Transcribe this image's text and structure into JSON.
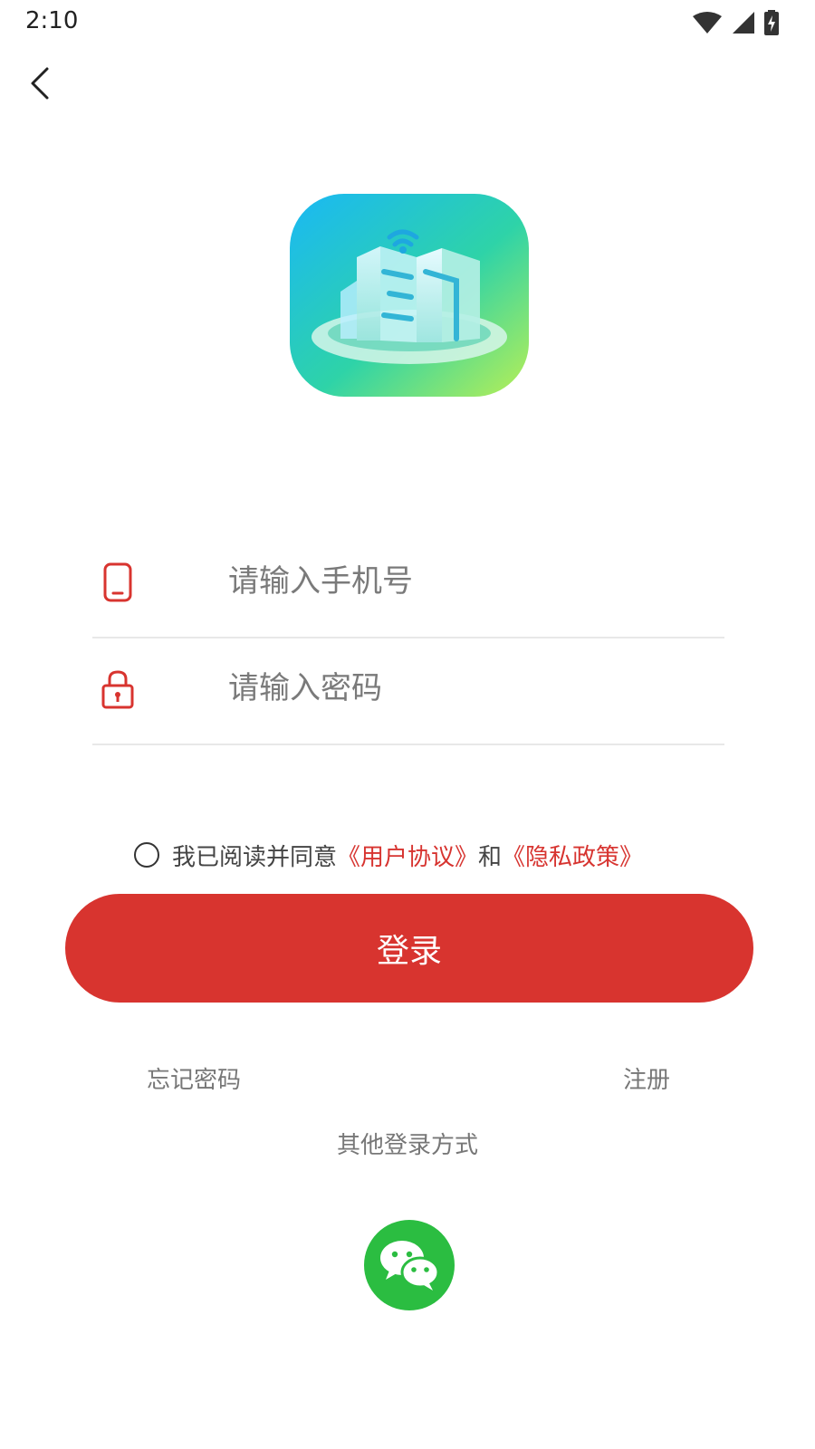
{
  "status_bar": {
    "time": "2:10",
    "icons": [
      "wifi-icon",
      "signal-icon",
      "battery-charging-icon"
    ]
  },
  "nav": {
    "back_icon": "chevron-left-icon"
  },
  "login_form": {
    "phone_placeholder": "请输入手机号",
    "phone_value": "",
    "phone_icon": "phone-icon",
    "password_placeholder": "请输入密码",
    "password_value": "",
    "password_icon": "lock-icon"
  },
  "agreement": {
    "prefix": "我已阅读并同意",
    "user_agreement": "《用户协议》",
    "conjunction": "和",
    "privacy_policy": "《隐私政策》",
    "checked": false
  },
  "actions": {
    "login_label": "登录",
    "forgot_password": "忘记密码",
    "register": "注册",
    "other_login": "其他登录方式",
    "wechat_icon": "wechat-icon"
  },
  "colors": {
    "accent": "#d8342f",
    "link": "#d73430",
    "wechat": "#2bbd41"
  }
}
